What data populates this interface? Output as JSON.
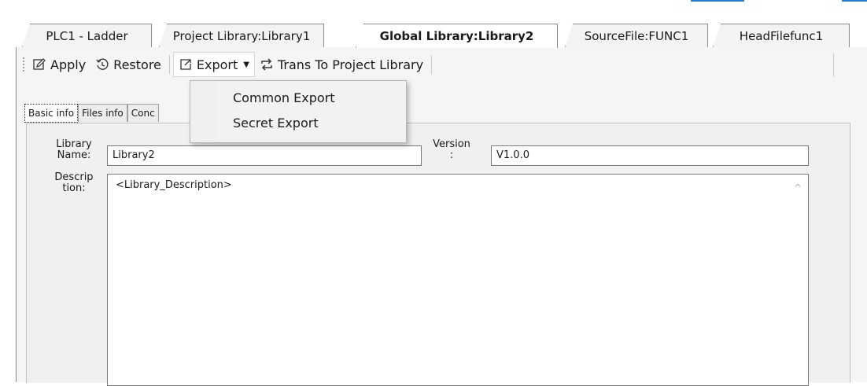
{
  "tabs": [
    {
      "label": "PLC1 - Ladder",
      "active": false
    },
    {
      "label": "Project Library:Library1",
      "active": false
    },
    {
      "label": "Global Library:Library2",
      "active": true
    },
    {
      "label": "SourceFile:FUNC1",
      "active": false
    },
    {
      "label": "HeadFilefunc1",
      "active": false
    }
  ],
  "toolbar": {
    "apply_label": "Apply",
    "restore_label": "Restore",
    "export_label": "Export",
    "trans_label": "Trans To Project Library"
  },
  "export_menu": {
    "items": [
      "Common Export",
      "Secret Export"
    ]
  },
  "sub_tabs": [
    {
      "label": "Basic info",
      "active": true
    },
    {
      "label": "Files info",
      "active": false
    },
    {
      "label": "Conc",
      "active": false
    }
  ],
  "form": {
    "name_label_line1": "Library",
    "name_label_line2": "Name:",
    "name_value": "Library2",
    "version_label_line1": "Version",
    "version_label_line2": ":",
    "version_value": "V1.0.0",
    "desc_label_line1": "Descrip",
    "desc_label_line2": "tion:",
    "desc_value": "<Library_Description>"
  },
  "icons": {
    "apply": "edit-icon",
    "restore": "restore-icon",
    "export": "export-icon",
    "trans": "sync-icon",
    "scroll": "scroll-up-icon"
  },
  "colors": {
    "accent": "#1e7fd6",
    "panel": "#f5f5f5",
    "tab_border": "#8c8c8c"
  }
}
